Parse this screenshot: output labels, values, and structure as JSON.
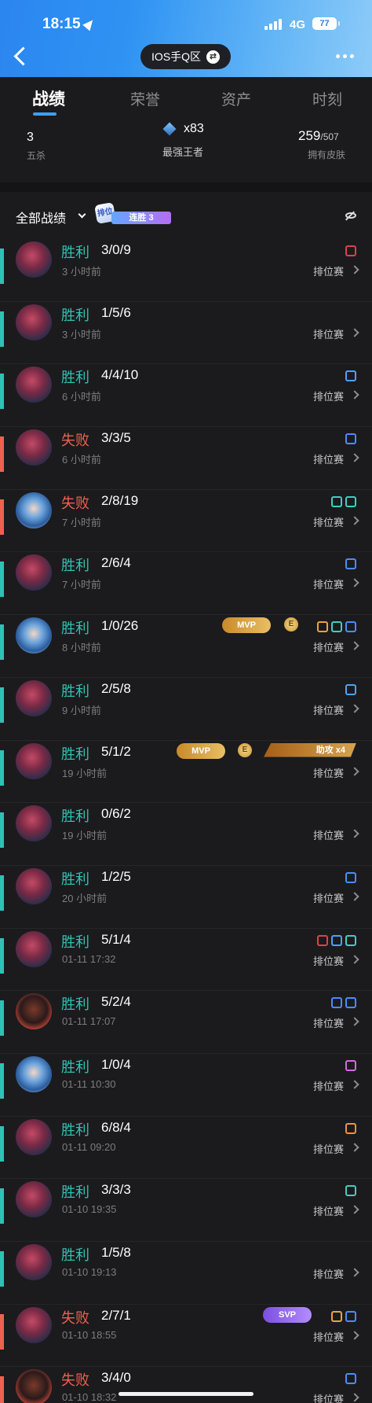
{
  "status_bar": {
    "time": "18:15",
    "network": "4G",
    "battery": "77"
  },
  "nav": {
    "region_label": "IOS手Q区"
  },
  "tabs": [
    {
      "label": "战绩",
      "active": true
    },
    {
      "label": "荣誉",
      "active": false
    },
    {
      "label": "资产",
      "active": false
    },
    {
      "label": "时刻",
      "active": false
    }
  ],
  "summary": {
    "left": {
      "value": "3",
      "label": "五杀"
    },
    "middle": {
      "value": "x83",
      "label": "最强王者"
    },
    "right": {
      "owned": "259",
      "total": "/507",
      "label": "拥有皮肤"
    }
  },
  "list": {
    "filter_label": "全部战绩",
    "streak_badge": "排位",
    "streak_text": "连胜 3"
  },
  "matches": [
    {
      "result": "胜利",
      "kda": "3/0/9",
      "time": "3 小时前",
      "mode": "排位赛",
      "hero": "a",
      "icons": [
        "#e0404b"
      ]
    },
    {
      "result": "胜利",
      "kda": "1/5/6",
      "time": "3 小时前",
      "mode": "排位赛",
      "hero": "a",
      "icons": []
    },
    {
      "result": "胜利",
      "kda": "4/4/10",
      "time": "6 小时前",
      "mode": "排位赛",
      "hero": "a",
      "icons": [
        "#4aa3ff"
      ]
    },
    {
      "result": "失败",
      "kda": "3/3/5",
      "time": "6 小时前",
      "mode": "排位赛",
      "hero": "a",
      "icons": [
        "#4a8cff"
      ]
    },
    {
      "result": "失败",
      "kda": "2/8/19",
      "time": "7 小时前",
      "mode": "排位赛",
      "hero": "b",
      "icons": [
        "#3ecfc1",
        "#3ecfc1"
      ]
    },
    {
      "result": "胜利",
      "kda": "2/6/4",
      "time": "7 小时前",
      "mode": "排位赛",
      "hero": "a",
      "icons": [
        "#4a8cff"
      ]
    },
    {
      "result": "胜利",
      "kda": "1/0/26",
      "time": "8 小时前",
      "mode": "排位赛",
      "hero": "b",
      "badge": "mvp",
      "mvp_label": "MVP",
      "coin_label": "E",
      "icons": [
        "#f0a23a",
        "#3ecfc1",
        "#4a8cff"
      ]
    },
    {
      "result": "胜利",
      "kda": "2/5/8",
      "time": "9 小时前",
      "mode": "排位赛",
      "hero": "a",
      "icons": [
        "#4aa3ff"
      ]
    },
    {
      "result": "胜利",
      "kda": "5/1/2",
      "time": "19 小时前",
      "mode": "排位赛",
      "hero": "a",
      "badge": "mvp-medal",
      "mvp_label": "MVP",
      "coin_label": "E",
      "medal_label": "助攻 x4",
      "icons": []
    },
    {
      "result": "胜利",
      "kda": "0/6/2",
      "time": "19 小时前",
      "mode": "排位赛",
      "hero": "a",
      "icons": []
    },
    {
      "result": "胜利",
      "kda": "1/2/5",
      "time": "20 小时前",
      "mode": "排位赛",
      "hero": "a",
      "icons": [
        "#4a8cff"
      ]
    },
    {
      "result": "胜利",
      "kda": "5/1/4",
      "time": "01-11 17:32",
      "mode": "排位赛",
      "hero": "a",
      "icons": [
        "#e0404b",
        "#4aa3ff",
        "#3ecfc1"
      ]
    },
    {
      "result": "胜利",
      "kda": "5/2/4",
      "time": "01-11 17:07",
      "mode": "排位赛",
      "hero": "c",
      "icons": [
        "#4a8cff",
        "#4a8cff"
      ]
    },
    {
      "result": "胜利",
      "kda": "1/0/4",
      "time": "01-11 10:30",
      "mode": "排位赛",
      "hero": "b",
      "icons": [
        "#d46adf"
      ]
    },
    {
      "result": "胜利",
      "kda": "6/8/4",
      "time": "01-11 09:20",
      "mode": "排位赛",
      "hero": "a",
      "icons": [
        "#f0923a"
      ]
    },
    {
      "result": "胜利",
      "kda": "3/3/3",
      "time": "01-10 19:35",
      "mode": "排位赛",
      "hero": "a",
      "icons": [
        "#3ecfc1"
      ]
    },
    {
      "result": "胜利",
      "kda": "1/5/8",
      "time": "01-10 19:13",
      "mode": "排位赛",
      "hero": "a",
      "icons": []
    },
    {
      "result": "失败",
      "kda": "2/7/1",
      "time": "01-10 18:55",
      "mode": "排位赛",
      "hero": "a",
      "badge": "svp",
      "svp_label": "SVP",
      "icons": [
        "#f0a23a",
        "#4a8cff"
      ]
    },
    {
      "result": "失败",
      "kda": "3/4/0",
      "time": "01-10 18:32",
      "mode": "排位赛",
      "hero": "c",
      "icons": [
        "#4a8cff"
      ]
    }
  ],
  "colors": {
    "win": "#2fc1b5",
    "loss": "#f0604f",
    "accent": "#3aa0ff"
  }
}
